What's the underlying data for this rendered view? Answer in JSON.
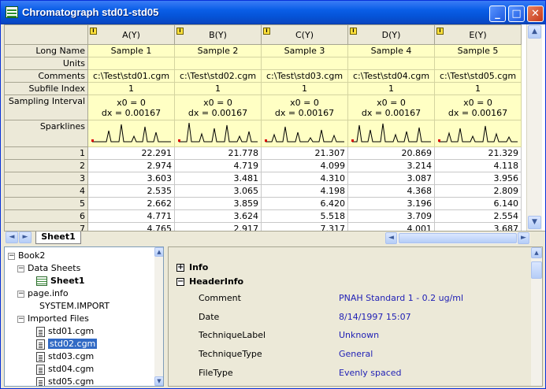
{
  "window": {
    "title": "Chromatograph std01-std05"
  },
  "columns": [
    {
      "header": "A(Y)",
      "long_name": "Sample 1",
      "units": "",
      "comment": "c:\\Test\\std01.cgm",
      "subfile": "1",
      "x0": "x0 = 0",
      "dx": "dx = 0.00167"
    },
    {
      "header": "B(Y)",
      "long_name": "Sample 2",
      "units": "",
      "comment": "c:\\Test\\std02.cgm",
      "subfile": "1",
      "x0": "x0 = 0",
      "dx": "dx = 0.00167"
    },
    {
      "header": "C(Y)",
      "long_name": "Sample 3",
      "units": "",
      "comment": "c:\\Test\\std03.cgm",
      "subfile": "1",
      "x0": "x0 = 0",
      "dx": "dx = 0.00167"
    },
    {
      "header": "D(Y)",
      "long_name": "Sample 4",
      "units": "",
      "comment": "c:\\Test\\std04.cgm",
      "subfile": "1",
      "x0": "x0 = 0",
      "dx": "dx = 0.00167"
    },
    {
      "header": "E(Y)",
      "long_name": "Sample 5",
      "units": "",
      "comment": "c:\\Test\\std05.cgm",
      "subfile": "1",
      "x0": "x0 = 0",
      "dx": "dx = 0.00167"
    }
  ],
  "row_labels": {
    "long_name": "Long Name",
    "units": "Units",
    "comments": "Comments",
    "subfile": "Subfile Index",
    "sampling": "Sampling Interval",
    "sparklines": "Sparklines"
  },
  "rows": [
    {
      "n": "1",
      "v": [
        "22.291",
        "21.778",
        "21.307",
        "20.869",
        "21.329"
      ]
    },
    {
      "n": "2",
      "v": [
        "2.974",
        "4.719",
        "4.099",
        "3.214",
        "4.118"
      ]
    },
    {
      "n": "3",
      "v": [
        "3.603",
        "3.481",
        "4.310",
        "3.087",
        "3.956"
      ]
    },
    {
      "n": "4",
      "v": [
        "2.535",
        "3.065",
        "4.198",
        "4.368",
        "2.809"
      ]
    },
    {
      "n": "5",
      "v": [
        "2.662",
        "3.859",
        "6.420",
        "3.196",
        "6.140"
      ]
    },
    {
      "n": "6",
      "v": [
        "4.771",
        "3.624",
        "5.518",
        "3.709",
        "2.554"
      ]
    },
    {
      "n": "7",
      "v": [
        "4.765",
        "2.917",
        "7.317",
        "4.001",
        "3.687"
      ]
    }
  ],
  "sheet_tab": "Sheet1",
  "tree": {
    "book": "Book2",
    "data_sheets": "Data Sheets",
    "sheet1": "Sheet1",
    "page_info": "page.info",
    "system_import": "SYSTEM.IMPORT",
    "imported_files": "Imported Files",
    "files": [
      "std01.cgm",
      "std02.cgm",
      "std03.cgm",
      "std04.cgm",
      "std05.cgm"
    ]
  },
  "details": {
    "info": "Info",
    "header_info": "HeaderInfo",
    "fields": [
      {
        "k": "Comment",
        "v": "PNAH Standard 1 - 0.2 ug/ml"
      },
      {
        "k": "Date",
        "v": "8/14/1997 15:07"
      },
      {
        "k": "TechniqueLabel",
        "v": "Unknown"
      },
      {
        "k": "TechniqueType",
        "v": "General"
      },
      {
        "k": "FileType",
        "v": "Evenly spaced"
      }
    ]
  }
}
